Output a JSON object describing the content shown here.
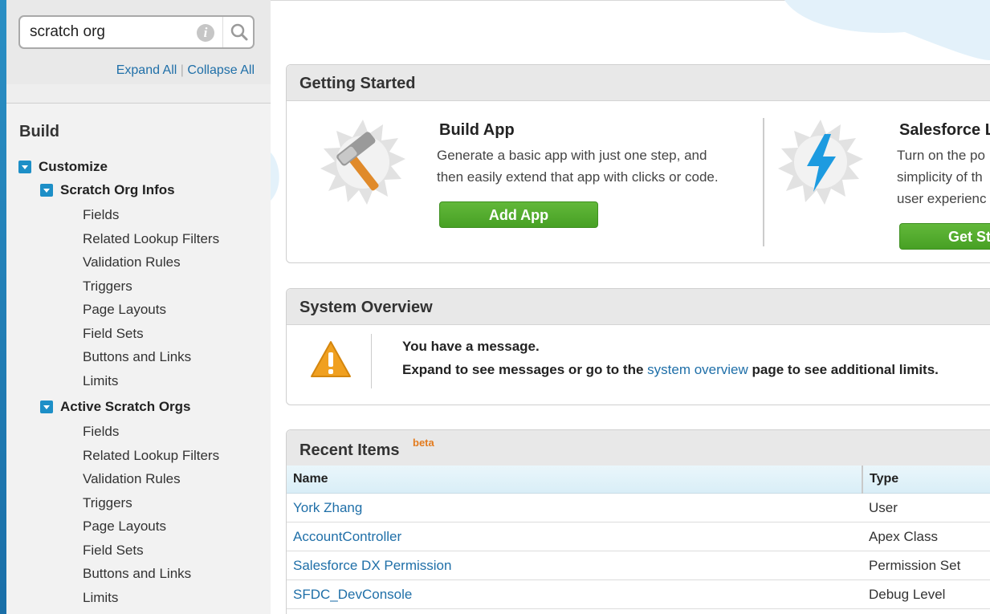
{
  "search": {
    "value": "scratch org"
  },
  "sidebar": {
    "expand_all": "Expand All",
    "separator": "|",
    "collapse_all": "Collapse All",
    "section_title": "Build",
    "customize": "Customize",
    "groups": [
      {
        "label": "Scratch Org Infos",
        "items": [
          "Fields",
          "Related Lookup Filters",
          "Validation Rules",
          "Triggers",
          "Page Layouts",
          "Field Sets",
          "Buttons and Links",
          "Limits"
        ]
      },
      {
        "label": "Active Scratch Orgs",
        "items": [
          "Fields",
          "Related Lookup Filters",
          "Validation Rules",
          "Triggers",
          "Page Layouts",
          "Field Sets",
          "Buttons and Links",
          "Limits"
        ]
      }
    ]
  },
  "getting_started": {
    "title": "Getting Started",
    "build_app": {
      "title": "Build App",
      "desc_line1": "Generate a basic app with just one step, and",
      "desc_line2": "then easily extend that app with clicks or code.",
      "button": "Add App"
    },
    "lightning": {
      "title": "Salesforce L",
      "desc_line1": "Turn on the po",
      "desc_line2": "simplicity of th",
      "desc_line3": "user experienc",
      "button": "Get St"
    }
  },
  "system_overview": {
    "title": "System Overview",
    "line1": "You have a message.",
    "line2_pre": "Expand to see messages or go to the ",
    "line2_link": "system overview",
    "line2_post": " page to see additional limits."
  },
  "recent_items": {
    "title": "Recent Items",
    "badge": "beta",
    "columns": [
      "Name",
      "Type"
    ],
    "rows": [
      {
        "name": "York Zhang",
        "type": "User"
      },
      {
        "name": "AccountController",
        "type": "Apex Class"
      },
      {
        "name": "Salesforce DX Permission",
        "type": "Permission Set"
      },
      {
        "name": "SFDC_DevConsole",
        "type": "Debug Level"
      }
    ]
  },
  "colors": {
    "accent": "#1d8fc7",
    "link": "#1f6fa8",
    "button_green": "#52ab2e",
    "beta": "#e37b1e"
  }
}
